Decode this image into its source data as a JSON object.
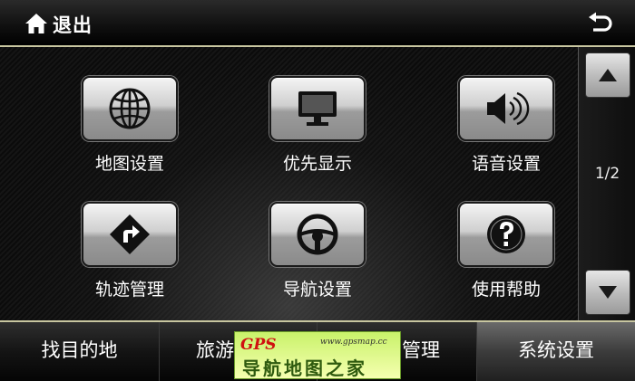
{
  "header": {
    "exit_label": "退出"
  },
  "grid": {
    "items": [
      {
        "label": "地图设置",
        "icon": "globe-icon"
      },
      {
        "label": "优先显示",
        "icon": "monitor-icon"
      },
      {
        "label": "语音设置",
        "icon": "speaker-icon"
      },
      {
        "label": "轨迹管理",
        "icon": "turn-sign-icon"
      },
      {
        "label": "导航设置",
        "icon": "steering-wheel-icon"
      },
      {
        "label": "使用帮助",
        "icon": "question-icon"
      }
    ]
  },
  "pager": {
    "text": "1/2"
  },
  "tabs": [
    {
      "label": "找目的地",
      "active": false
    },
    {
      "label": "旅游",
      "active": false
    },
    {
      "label": "管理",
      "active": false
    },
    {
      "label": "系统设置",
      "active": true
    }
  ],
  "watermark": {
    "brand": "GPS",
    "url": "www.gpsmap.cc",
    "text": "导航地图之家"
  }
}
